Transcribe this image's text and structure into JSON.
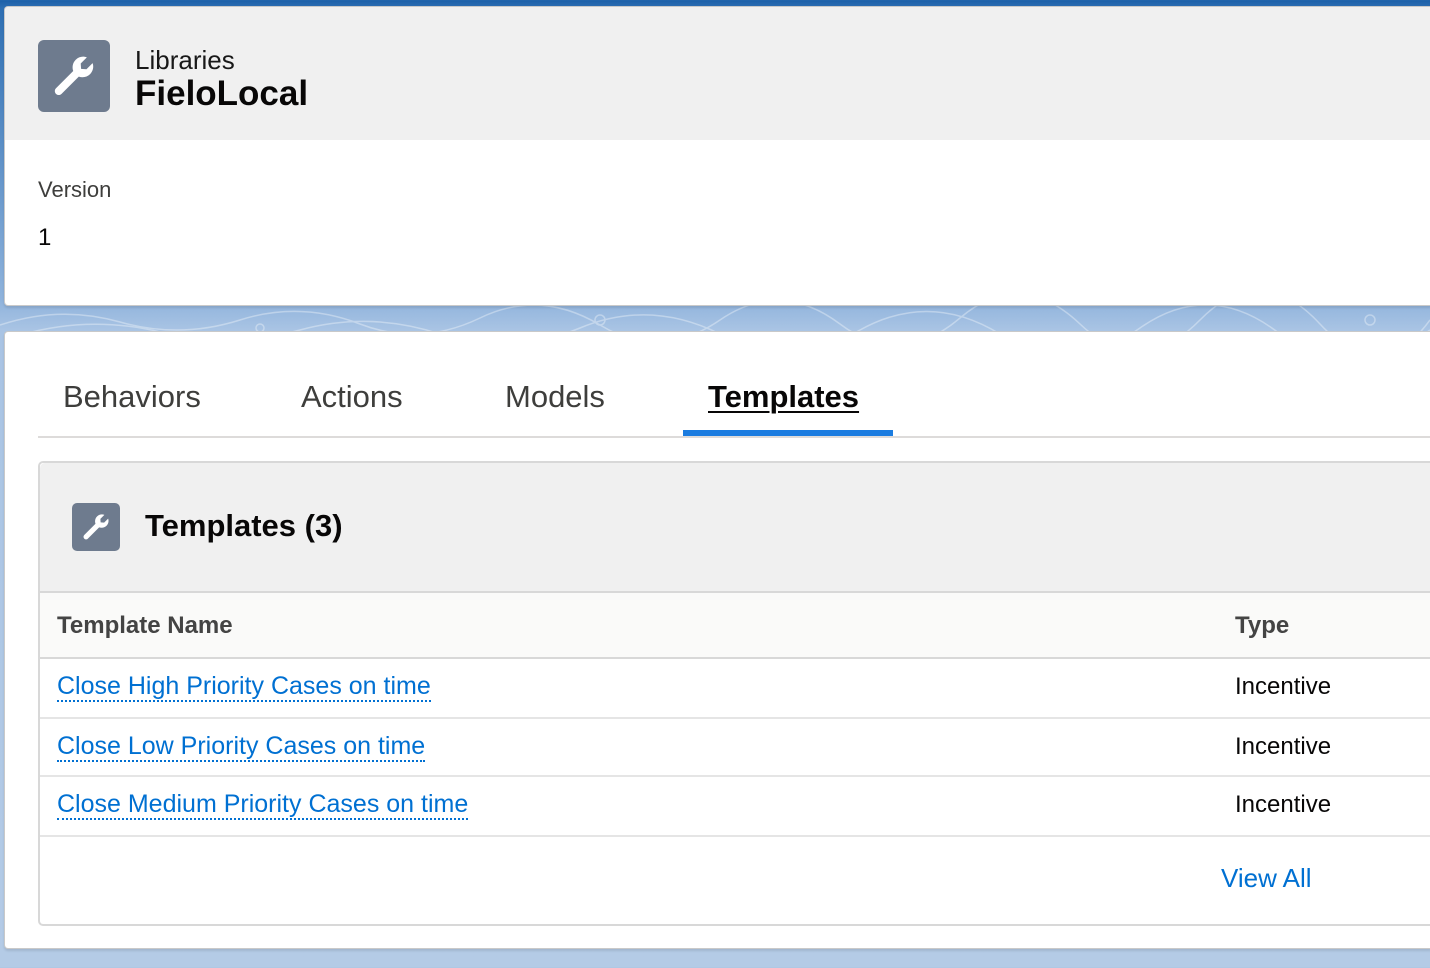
{
  "header": {
    "kicker": "Libraries",
    "title": "FieloLocal",
    "icon": "wrench-icon"
  },
  "fields": {
    "version_label": "Version",
    "version_value": "1"
  },
  "tabs": [
    {
      "label": "Behaviors",
      "active": false
    },
    {
      "label": "Actions",
      "active": false
    },
    {
      "label": "Models",
      "active": false
    },
    {
      "label": "Templates",
      "active": true
    }
  ],
  "related_list": {
    "icon": "wrench-icon",
    "title": "Templates (3)",
    "columns": [
      "Template Name",
      "Type"
    ],
    "rows": [
      {
        "name": "Close High Priority Cases on time",
        "type": "Incentive"
      },
      {
        "name": "Close Low Priority Cases on time",
        "type": "Incentive"
      },
      {
        "name": "Close Medium Priority Cases on time",
        "type": "Incentive"
      }
    ],
    "view_all": "View All"
  },
  "colors": {
    "link": "#0070d2",
    "tab_active_indicator": "#1b7ce0",
    "icon_background": "#6e7b8e"
  }
}
